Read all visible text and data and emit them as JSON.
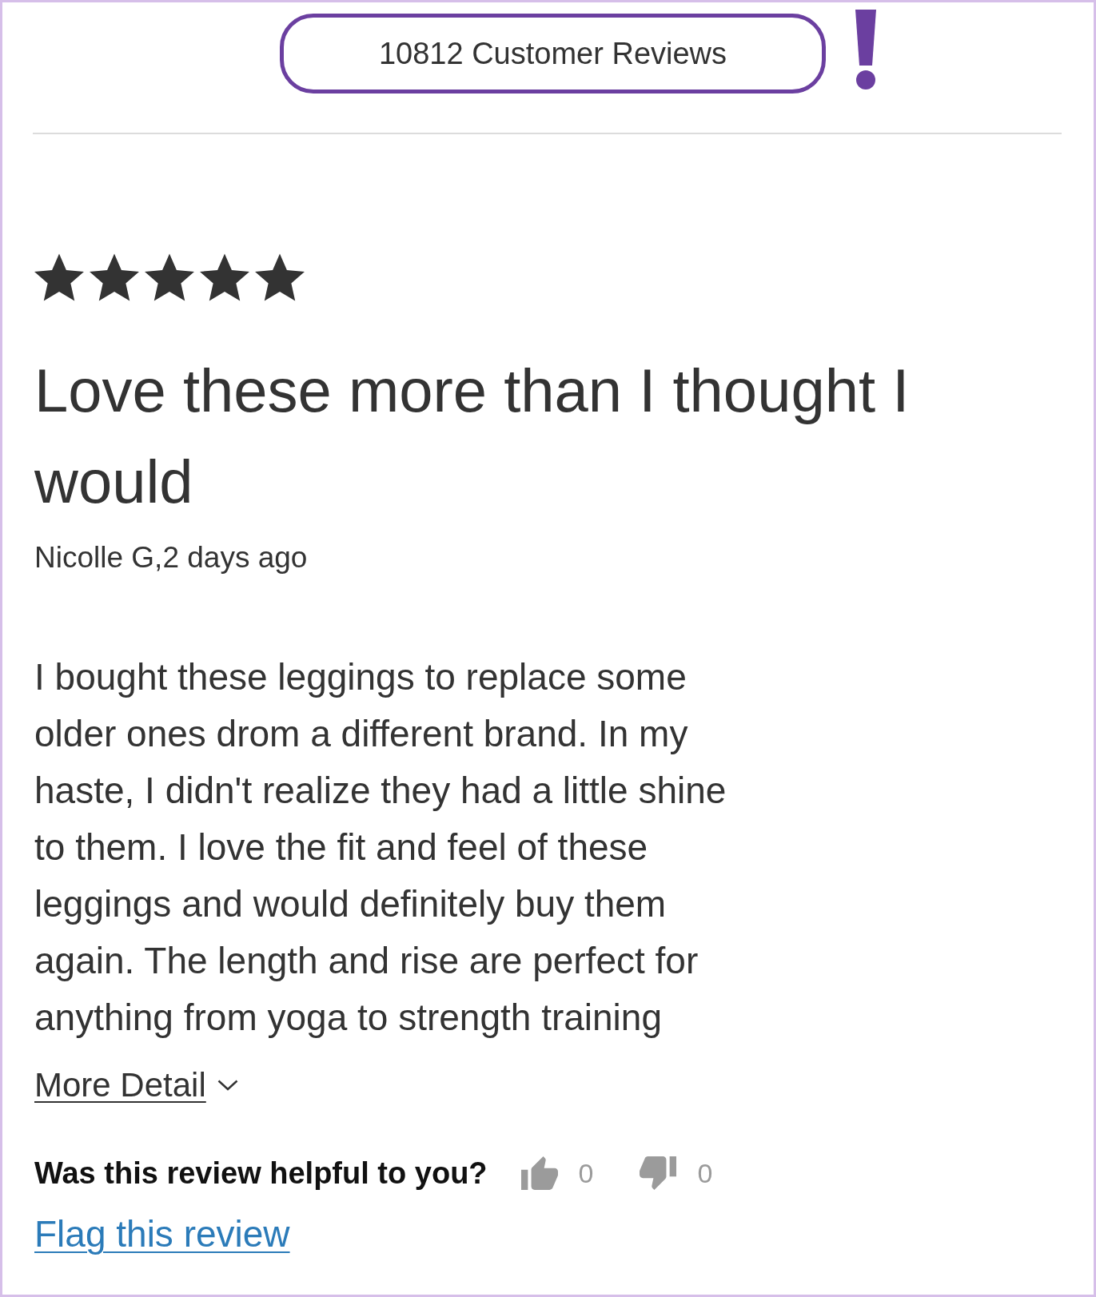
{
  "header": {
    "review_count": "10812 Customer Reviews"
  },
  "review": {
    "stars": 5,
    "title": "Love these more than I thought I would",
    "author": "Nicolle G,2 days ago",
    "body": "I bought these leggings to replace some older ones drom a different brand. In my haste, I didn't realize they had a little shine to them. I love the fit and feel of these leggings and would definitely buy them again. The length and rise are perfect for anything from yoga to strength training",
    "more_detail": "More Detail",
    "helpful_prompt": "Was this review helpful to you?",
    "helpful_votes": [
      {
        "kind": "up",
        "count": "0"
      },
      {
        "kind": "down",
        "count": "0"
      }
    ],
    "flag_link": "Flag this review"
  }
}
